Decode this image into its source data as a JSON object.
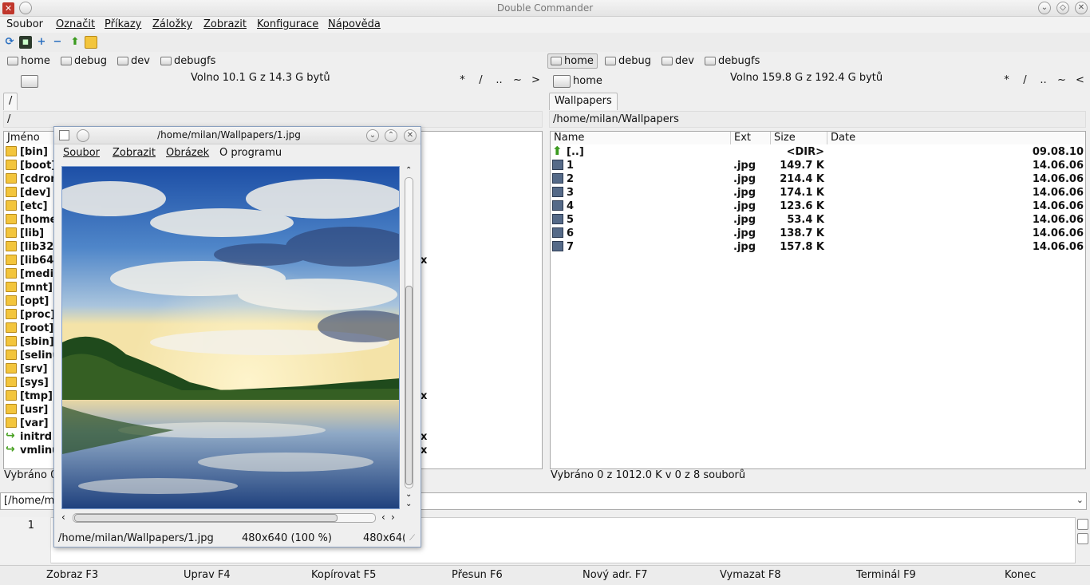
{
  "window": {
    "title": "Double Commander"
  },
  "menubar": [
    "Soubor",
    "Označit",
    "Příkazy",
    "Záložky",
    "Zobrazit",
    "Konfigurace",
    "Nápověda"
  ],
  "left": {
    "drives": [
      "home",
      "debug",
      "dev",
      "debugfs"
    ],
    "free": "Volno 10.1 G z 14.3 G bytů",
    "nav": [
      "*",
      "/",
      "..",
      "~",
      ">"
    ],
    "tab": "/",
    "path": "/",
    "col_name": "Jméno",
    "files": [
      "[bin]",
      "[boot]",
      "[cdrom",
      "[dev]",
      "[etc]",
      "[home",
      "[lib]",
      "[lib32",
      "[lib64",
      "[medi",
      "[mnt]",
      "[opt]",
      "[proc]",
      "[root]",
      "[sbin]",
      "[selinu",
      "[srv]",
      "[sys]",
      "[tmp]",
      "[usr]",
      "[var]",
      "initrd",
      "vmlinu"
    ],
    "right_marks": {
      "lib64": "x",
      "tmp": "x",
      "initrd": "x",
      "vmlinu": "x"
    },
    "status": "Vybráno 0"
  },
  "right": {
    "drives": [
      "home",
      "debug",
      "dev",
      "debugfs"
    ],
    "drive_label": "home",
    "free": "Volno 159.8 G z 192.4 G bytů",
    "nav": [
      "*",
      "/",
      "..",
      "~",
      "<"
    ],
    "tab": "Wallpapers",
    "path": "/home/milan/Wallpapers",
    "columns": {
      "name": "Name",
      "ext": "Ext",
      "size": "Size",
      "date": "Date"
    },
    "rows": [
      {
        "name": "[..]",
        "ext": "",
        "size": "<DIR>",
        "date": "09.08.10"
      },
      {
        "name": "1",
        "ext": ".jpg",
        "size": "149.7 K",
        "date": "14.06.06"
      },
      {
        "name": "2",
        "ext": ".jpg",
        "size": "214.4 K",
        "date": "14.06.06"
      },
      {
        "name": "3",
        "ext": ".jpg",
        "size": "174.1 K",
        "date": "14.06.06"
      },
      {
        "name": "4",
        "ext": ".jpg",
        "size": "123.6 K",
        "date": "14.06.06"
      },
      {
        "name": "5",
        "ext": ".jpg",
        "size": "53.4 K",
        "date": "14.06.06"
      },
      {
        "name": "6",
        "ext": ".jpg",
        "size": "138.7 K",
        "date": "14.06.06"
      },
      {
        "name": "7",
        "ext": ".jpg",
        "size": "157.8 K",
        "date": "14.06.06"
      }
    ],
    "status": "Vybráno 0 z 1012.0 K v 0 z 8 souborů"
  },
  "cmdline": {
    "value": "[/home/mi"
  },
  "editor": {
    "line": "1"
  },
  "fkeys": [
    "Zobraz F3",
    "Uprav F4",
    "Kopírovat F5",
    "Přesun F6",
    "Nový adr. F7",
    "Vymazat F8",
    "Terminál F9",
    "Konec"
  ],
  "viewer": {
    "title": "/home/milan/Wallpapers/1.jpg",
    "menu": [
      "Soubor",
      "Zobrazit",
      "Obrázek",
      "O programu"
    ],
    "status_path": "/home/milan/Wallpapers/1.jpg",
    "status_res": "480x640 (100 %)",
    "status_res2": "480x64("
  },
  "colors": {
    "selection_border": "#7f9fd0",
    "folder": "#f3c53c",
    "up_arrow": "#3a9a1e"
  }
}
